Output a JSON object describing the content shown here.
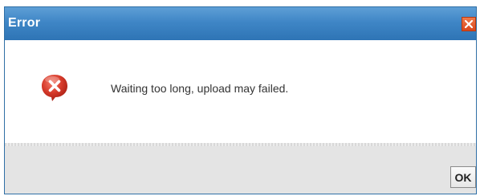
{
  "dialog": {
    "title": "Error",
    "message": "Waiting too long, upload may failed.",
    "ok_label": "OK",
    "close_icon": "close-icon",
    "status_icon": "error-icon"
  },
  "colors": {
    "titlebar": "#3f86c6",
    "close_button": "#d9461c",
    "error_icon": "#d63a2a",
    "footer": "#e4e4e4"
  }
}
